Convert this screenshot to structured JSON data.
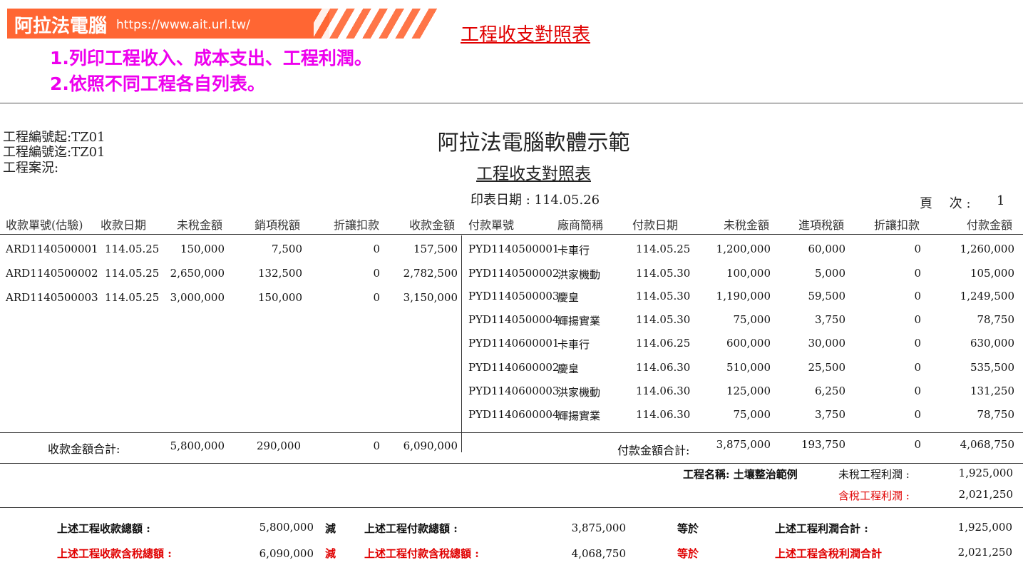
{
  "banner": {
    "brand": "阿拉法電腦",
    "url": "https://www.ait.url.tw/",
    "top_title": "工程收支對照表",
    "notes": [
      {
        "num": "1.",
        "text": "列印工程收入、成本支出、工程利潤。"
      },
      {
        "num": "2.",
        "text": "依照不同工程各自列表。"
      }
    ]
  },
  "header": {
    "filter_from": "工程編號起:TZ01",
    "filter_to": "工程編號迄:TZ01",
    "status": "工程案況:",
    "company": "阿拉法電腦軟體示範",
    "report_title": "工程收支對照表",
    "print_date": "印表日期 : 114.05.26",
    "page_label": "頁　 次 :",
    "page_num": "1"
  },
  "receipts": {
    "columns": [
      "收款單號(估驗)",
      "收款日期",
      "未稅金額",
      "銷項稅額",
      "折讓扣款",
      "收款金額"
    ],
    "rows": [
      [
        "ARD1140500001",
        "114.05.25",
        "150,000",
        "7,500",
        "0",
        "157,500"
      ],
      [
        "ARD1140500002",
        "114.05.25",
        "2,650,000",
        "132,500",
        "0",
        "2,782,500"
      ],
      [
        "ARD1140500003",
        "114.05.25",
        "3,000,000",
        "150,000",
        "0",
        "3,150,000"
      ]
    ],
    "total_label": "收款金額合計:",
    "totals": [
      "5,800,000",
      "290,000",
      "0",
      "6,090,000"
    ]
  },
  "payments": {
    "columns": [
      "付款單號",
      "廠商簡稱",
      "付款日期",
      "未稅金額",
      "進項稅額",
      "折讓扣款",
      "付款金額"
    ],
    "rows": [
      [
        "PYD1140500001",
        "卡車行",
        "114.05.25",
        "1,200,000",
        "60,000",
        "0",
        "1,260,000"
      ],
      [
        "PYD1140500002",
        "洪家機動",
        "114.05.30",
        "100,000",
        "5,000",
        "0",
        "105,000"
      ],
      [
        "PYD1140500003",
        "慶皇",
        "114.05.30",
        "1,190,000",
        "59,500",
        "0",
        "1,249,500"
      ],
      [
        "PYD1140500004",
        "輝揚實業",
        "114.05.30",
        "75,000",
        "3,750",
        "0",
        "78,750"
      ],
      [
        "PYD1140600001",
        "卡車行",
        "114.06.25",
        "600,000",
        "30,000",
        "0",
        "630,000"
      ],
      [
        "PYD1140600002",
        "慶皇",
        "114.06.30",
        "510,000",
        "25,500",
        "0",
        "535,500"
      ],
      [
        "PYD1140600003",
        "洪家機動",
        "114.06.30",
        "125,000",
        "6,250",
        "0",
        "131,250"
      ],
      [
        "PYD1140600004",
        "輝揚實業",
        "114.06.30",
        "75,000",
        "3,750",
        "0",
        "78,750"
      ]
    ],
    "total_label": "付款金額合計:",
    "totals": [
      "3,875,000",
      "193,750",
      "0",
      "4,068,750"
    ]
  },
  "profit": {
    "project_name": "工程名稱: 土壤整治範例",
    "pretax_label": "未稅工程利潤 :",
    "pretax_value": "1,925,000",
    "taxed_label": "含稅工程利潤 :",
    "taxed_value": "2,021,250"
  },
  "summary": [
    {
      "income_label": "上述工程收款總額 :",
      "income": "5,800,000",
      "minus": "減",
      "cost_label": "上述工程付款總額 :",
      "cost": "3,875,000",
      "equals": "等於",
      "result_label": "上述工程利潤合計 :",
      "result": "1,925,000"
    },
    {
      "income_label": "上述工程收款含稅總額 :",
      "income": "6,090,000",
      "minus": "減",
      "cost_label": "上述工程付款含稅總額 :",
      "cost": "4,068,750",
      "equals": "等於",
      "result_label": "上述工程含稅利潤合計",
      "result": "2,021,250"
    }
  ],
  "colors": {
    "banner": "#ff6633",
    "accent_red": "#e00000",
    "note_magenta": "#ee00ee"
  }
}
